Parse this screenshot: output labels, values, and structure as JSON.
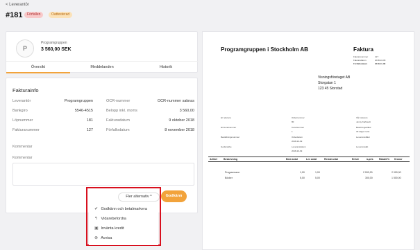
{
  "header": {
    "back_label": "< Leverantör",
    "invoice_number": "#181",
    "badges": [
      "Förfallen",
      "Oattesterad"
    ]
  },
  "supplier": {
    "avatar_letter": "P",
    "label": "Programgruppen",
    "amount": "3 560,00 SEK"
  },
  "tabs": [
    "Översikt",
    "Meddelanden",
    "Historik"
  ],
  "info": {
    "title": "Fakturainfo",
    "rows": [
      {
        "k1": "Leverantör",
        "v1": "Programgruppen",
        "k2": "OCR-nummer",
        "v2": "OCR-nummer saknas"
      },
      {
        "k1": "Bankgiro",
        "v1": "5546-4515",
        "k2": "Belopp inkl. moms",
        "v2": "3 560,00"
      },
      {
        "k1": "Löpnummer",
        "v1": "181",
        "k2": "Fakturadatum",
        "v2": "9 oktober 2018"
      },
      {
        "k1": "Fakturanummer",
        "v1": "127",
        "k2": "Förfallodatum",
        "v2": "8 november 2018"
      }
    ],
    "comment_label": "Kommentar",
    "comment_field_label": "Kommentar"
  },
  "actions": {
    "more_label": "Fler alternativ ^",
    "approve_label": "Godkänn",
    "menu": [
      {
        "icon": "double-check-icon",
        "glyph": "✔",
        "label": "Godkänn och betalmarkera"
      },
      {
        "icon": "forward-icon",
        "glyph": "↰",
        "label": "Vidarebefordra"
      },
      {
        "icon": "credit-icon",
        "glyph": "▣",
        "label": "Invänta kredit"
      },
      {
        "icon": "reject-icon",
        "glyph": "⊗",
        "label": "Avvisa"
      }
    ]
  },
  "document": {
    "company": "Programgruppen i Stockholm AB",
    "title": "Faktura",
    "meta": [
      {
        "k": "Fakturanummer",
        "v": "127"
      },
      {
        "k": "Fakturadatum",
        "v": "2018-10-09"
      },
      {
        "k": "Förfallodatum",
        "v": "2018-11-08"
      }
    ],
    "recipient": [
      "Visningsföretaget AB",
      "Storgatan 1",
      "123 45   Storstad"
    ],
    "table_headers": [
      "Artikel",
      "Beskrivning",
      "Best antal",
      "Lev antal",
      "Restat antal",
      "Enhet",
      "à-pris",
      "Rabatt %",
      "Kronor"
    ],
    "rows": [
      {
        "desc": "Programvaror",
        "best": "1,00",
        "lev": "1,00",
        "apris": "2 000,00",
        "kr": "2 000,00"
      },
      {
        "desc": "Böcker",
        "best": "5,00",
        "lev": "5,00",
        "apris": "300,00",
        "kr": "1 500,00"
      }
    ],
    "small_info": {
      "ref_label": "Er referens",
      "ordernr_label": "Ordernummer",
      "ordernr": "80",
      "our_ref_label": "Vår referens",
      "our_ref": "Jenny Karlstedt",
      "cust_label": "Ert kundnummer",
      "cust_val_label": "Kundnummer",
      "cust_val": "1",
      "terms_label": "Betalningsvillkor",
      "terms": "30 dagar netto",
      "order_label": "Beställningsnummer",
      "order_date_label": "Orderdatum",
      "order_date": "2018-10-09",
      "delivery_label": "Leveransvillkor",
      "shipping_label": "Godsmärke",
      "lev_label": "Leveransdatum",
      "lev_date": "2018-10-09",
      "levsatt_label": "Leveranssätt"
    }
  }
}
